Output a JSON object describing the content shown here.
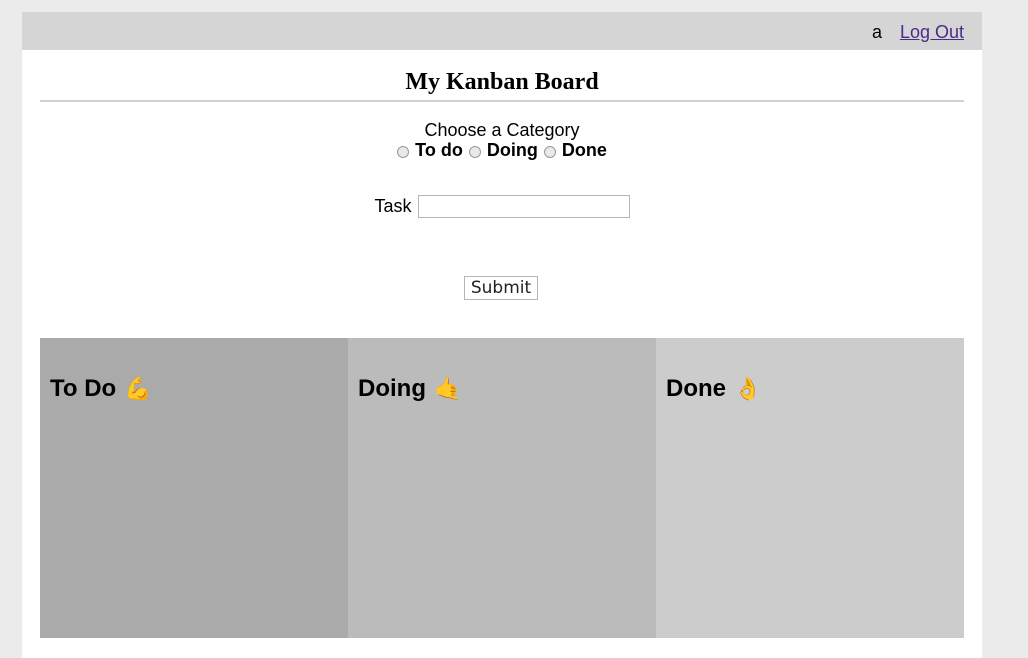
{
  "header": {
    "username": "a",
    "logout_label": "Log Out"
  },
  "board": {
    "title": "My Kanban Board"
  },
  "form": {
    "category_label": "Choose a Category",
    "categories": [
      {
        "label": "To do"
      },
      {
        "label": "Doing"
      },
      {
        "label": "Done"
      }
    ],
    "task_label": "Task",
    "task_value": "",
    "task_placeholder": "",
    "submit_label": "Submit"
  },
  "columns": [
    {
      "title": "To Do",
      "emoji": "💪",
      "icon": "flexed-biceps-icon",
      "color": "#aaaaaa"
    },
    {
      "title": "Doing",
      "emoji": "🤙",
      "icon": "call-me-hand-icon",
      "color": "#bbbbbb"
    },
    {
      "title": "Done",
      "emoji": "👌",
      "icon": "ok-hand-icon",
      "color": "#cccccc"
    }
  ],
  "colors": {
    "page_background": "#ebebeb",
    "topbar_background": "#d5d5d5",
    "link_color": "#4b2a8a"
  }
}
